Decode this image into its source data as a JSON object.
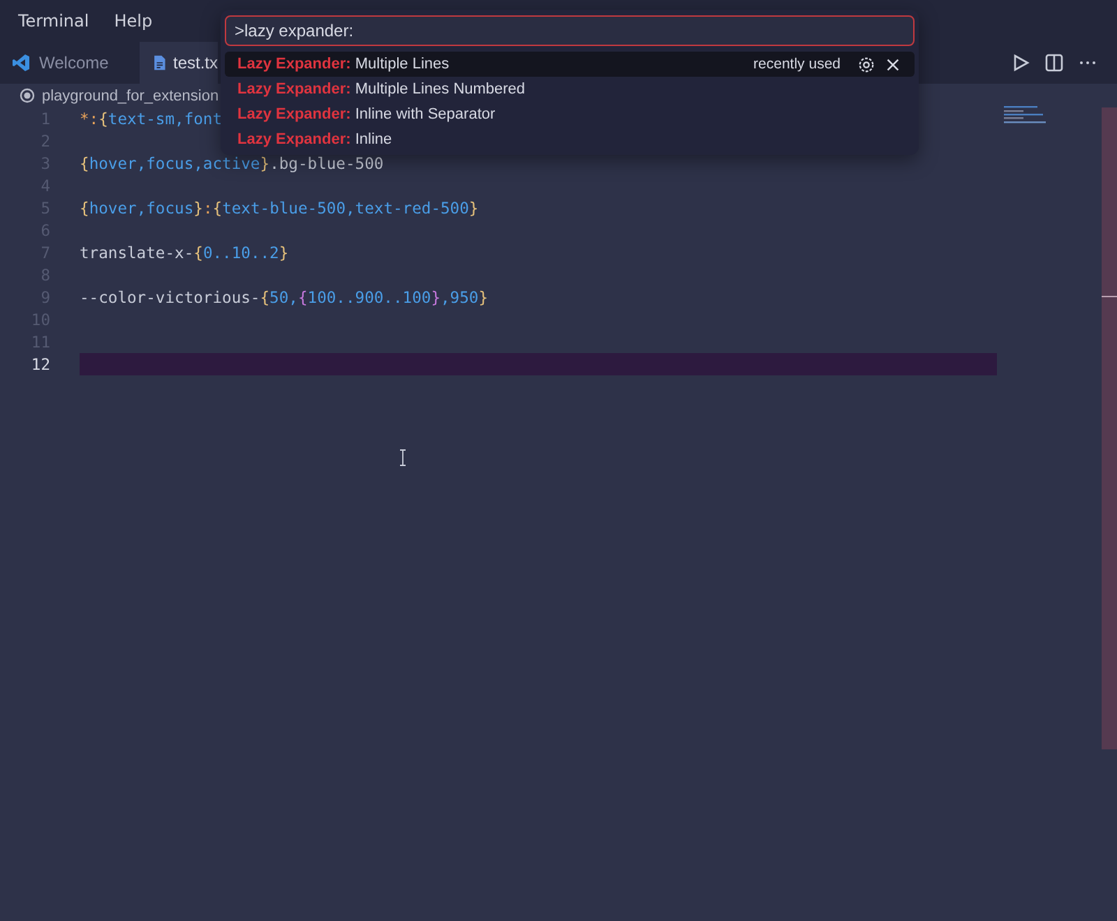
{
  "menu": [
    "Terminal",
    "Help"
  ],
  "tabs": [
    {
      "label": "Welcome",
      "selected": false,
      "kind": "vscode"
    },
    {
      "label": "test.tx",
      "selected": true,
      "kind": "file"
    }
  ],
  "breadcrumb": "playground_for_extension",
  "editor": {
    "lines": [
      {
        "number": "1",
        "current": false,
        "tokens": [
          {
            "t": "*:",
            "kind": "op"
          },
          {
            "t": "{",
            "kind": "brace"
          },
          {
            "t": "text-sm,font",
            "kind": "word"
          }
        ]
      },
      {
        "number": "2",
        "current": false
      },
      {
        "number": "3",
        "current": false,
        "tokens": [
          {
            "t": "{",
            "kind": "brace"
          },
          {
            "t": "hover,focus,active",
            "kind": "word"
          },
          {
            "t": "}",
            "kind": "brace"
          },
          {
            "t": ".bg-blue-500",
            "kind": "plain"
          }
        ]
      },
      {
        "number": "4",
        "current": false
      },
      {
        "number": "5",
        "current": false,
        "tokens": [
          {
            "t": "{",
            "kind": "brace"
          },
          {
            "t": "hover,focus",
            "kind": "word"
          },
          {
            "t": "}",
            "kind": "brace"
          },
          {
            "t": ":",
            "kind": "op"
          },
          {
            "t": "{",
            "kind": "brace"
          },
          {
            "t": "text-blue-500,text-red-500",
            "kind": "word"
          },
          {
            "t": "}",
            "kind": "brace"
          }
        ]
      },
      {
        "number": "6",
        "current": false
      },
      {
        "number": "7",
        "current": false,
        "tokens": [
          {
            "t": "translate-x-",
            "kind": "plain"
          },
          {
            "t": "{",
            "kind": "brace"
          },
          {
            "t": "0..10..2",
            "kind": "word"
          },
          {
            "t": "}",
            "kind": "brace"
          }
        ]
      },
      {
        "number": "8",
        "current": false
      },
      {
        "number": "9",
        "current": false,
        "tokens": [
          {
            "t": "--color-victorious-",
            "kind": "plain"
          },
          {
            "t": "{",
            "kind": "brace"
          },
          {
            "t": "50,",
            "kind": "word"
          },
          {
            "t": "{",
            "kind": "nested"
          },
          {
            "t": "100..900..100",
            "kind": "word"
          },
          {
            "t": "}",
            "kind": "nested"
          },
          {
            "t": ",950",
            "kind": "word"
          },
          {
            "t": "}",
            "kind": "brace"
          }
        ]
      },
      {
        "number": "10",
        "current": false
      },
      {
        "number": "11",
        "current": false
      },
      {
        "number": "12",
        "current": true
      }
    ]
  },
  "palette": {
    "value": ">lazy expander:",
    "items": [
      {
        "prefix": "Lazy Expander:",
        "label": "Multiple Lines",
        "selected": true,
        "note": "recently used"
      },
      {
        "prefix": "Lazy Expander:",
        "label": "Multiple Lines Numbered",
        "selected": false
      },
      {
        "prefix": "Lazy Expander:",
        "label": "Inline with Separator",
        "selected": false
      },
      {
        "prefix": "Lazy Expander:",
        "label": "Inline",
        "selected": false
      }
    ]
  }
}
